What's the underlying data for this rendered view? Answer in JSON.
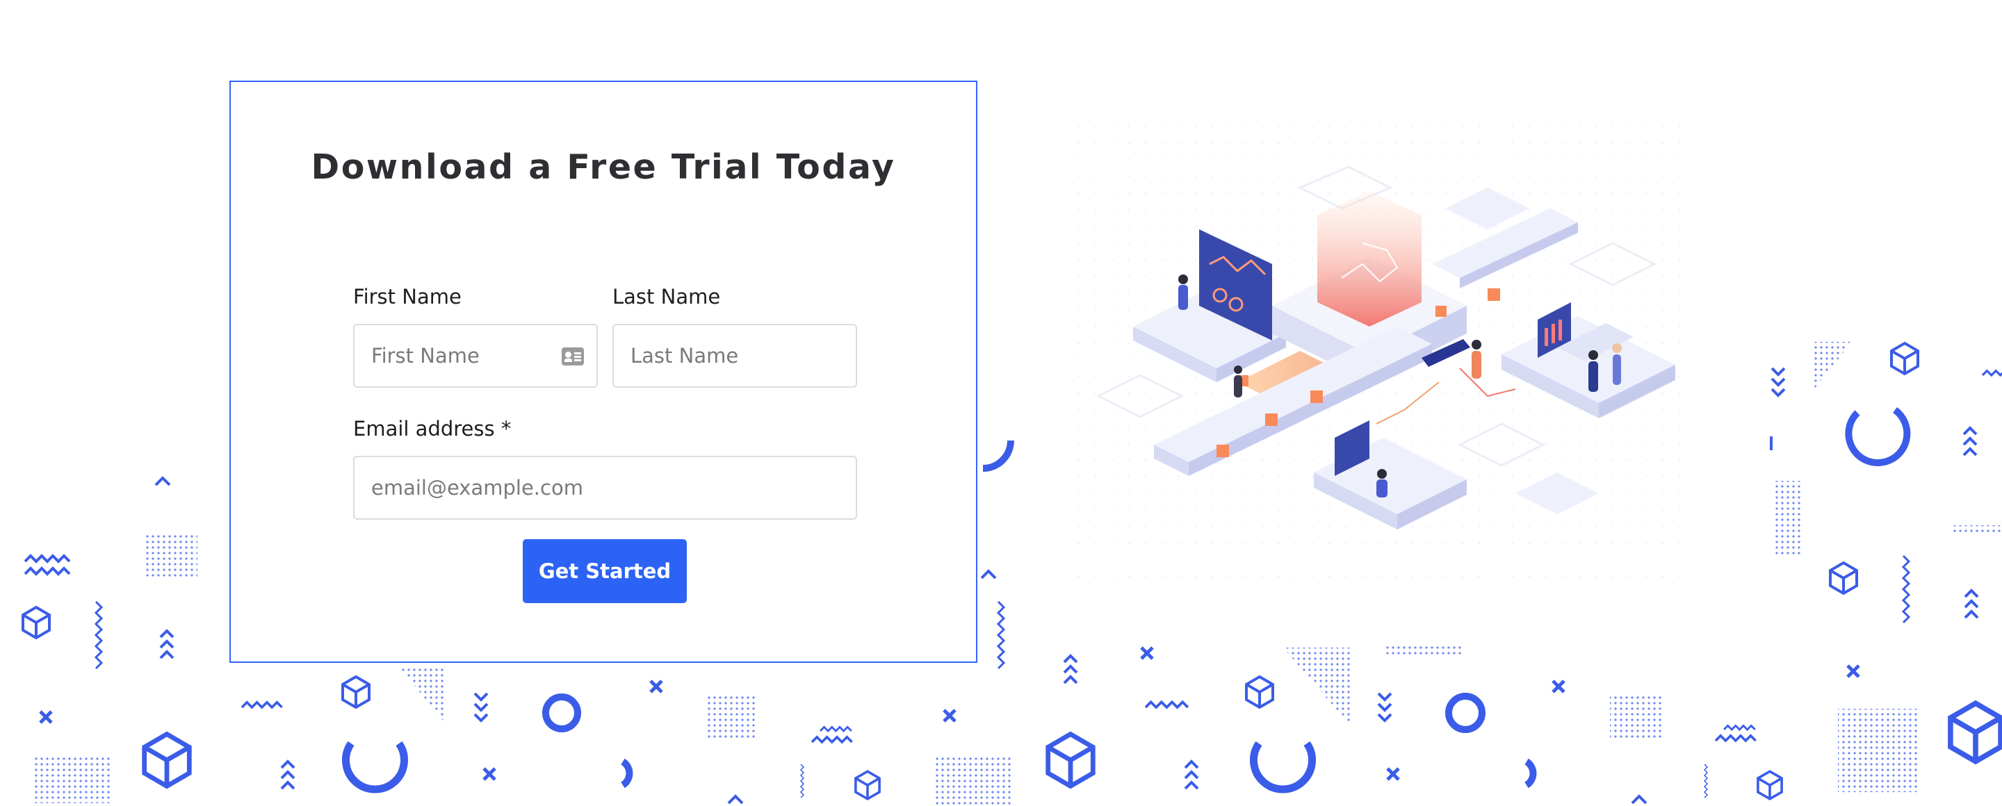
{
  "form": {
    "title": "Download a Free Trial Today",
    "first_name_label": "First Name",
    "first_name_placeholder": "First Name",
    "last_name_label": "Last Name",
    "last_name_placeholder": "Last Name",
    "email_label": "Email address *",
    "email_placeholder": "email@example.com",
    "submit_label": "Get Started"
  },
  "colors": {
    "accent": "#2c63f5",
    "card_border": "#3264ff",
    "pattern": "#3b5ce8",
    "illustration_base": "#e9ebfb"
  },
  "icons": [
    "contact-card-icon",
    "cube-icon",
    "zigzag-icon",
    "chevron-up-icon",
    "chevron-down-icon",
    "ring-icon",
    "cross-icon",
    "dot-grid-icon",
    "triangle-dots-icon",
    "arc-icon"
  ]
}
